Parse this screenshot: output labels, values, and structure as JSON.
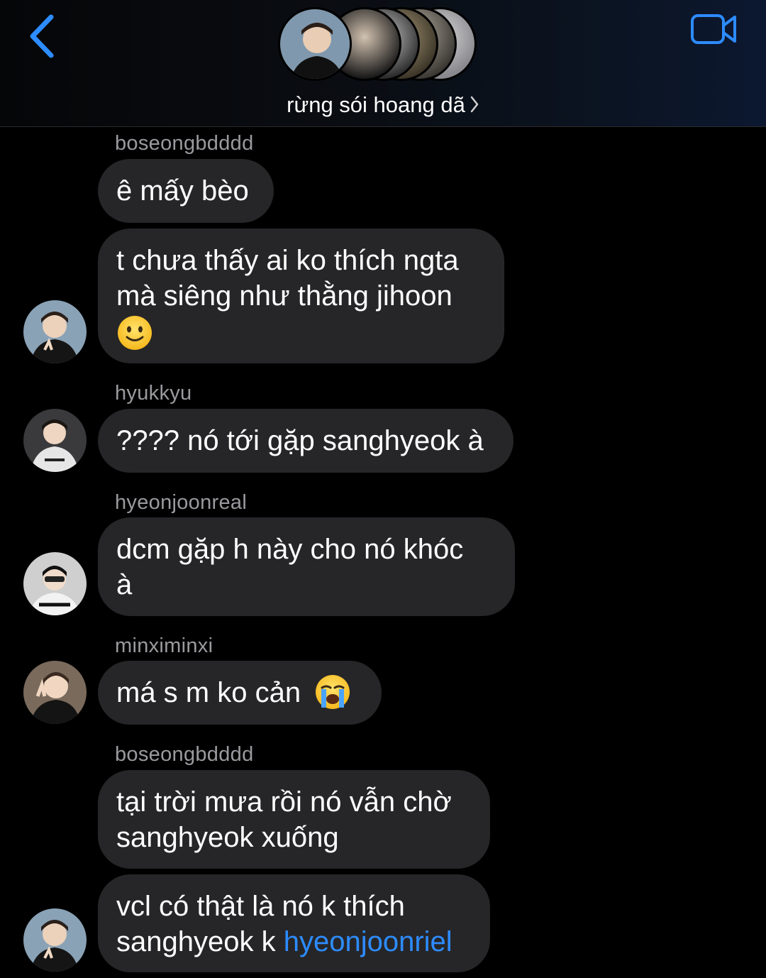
{
  "header": {
    "group_name": "rừng sói hoang dã",
    "accent_color": "#2d8cff",
    "icons": [
      "chevron-left-icon",
      "video-camera-icon",
      "chevron-right-icon"
    ]
  },
  "messages": [
    {
      "sender": "boseongbdddd",
      "lines": [
        "ê mấy bèo"
      ]
    },
    {
      "sender": "",
      "lines": [
        "t chưa thấy ai ko thích ngta",
        "mà siêng như thằng jihoon"
      ],
      "emoji": "slightly-smiling-face-emoji"
    },
    {
      "sender": "hyukkyu",
      "lines": [
        "???? nó tới gặp sanghyeok à"
      ]
    },
    {
      "sender": "hyeonjoonreal",
      "lines": [
        "dcm gặp h này cho nó khóc",
        "à"
      ]
    },
    {
      "sender": "minximinxi",
      "lines": [
        "má s m ko cản"
      ],
      "emoji": "loudly-crying-face-emoji"
    },
    {
      "sender": "boseongbdddd",
      "lines": [
        "tại trời mưa rồi nó vẫn chờ",
        "sanghyeok xuống"
      ]
    },
    {
      "sender": "",
      "lines": [
        "vcl có thật là nó k thích",
        "sanghyeok k "
      ],
      "mention": "hyeonjoonriel"
    }
  ]
}
